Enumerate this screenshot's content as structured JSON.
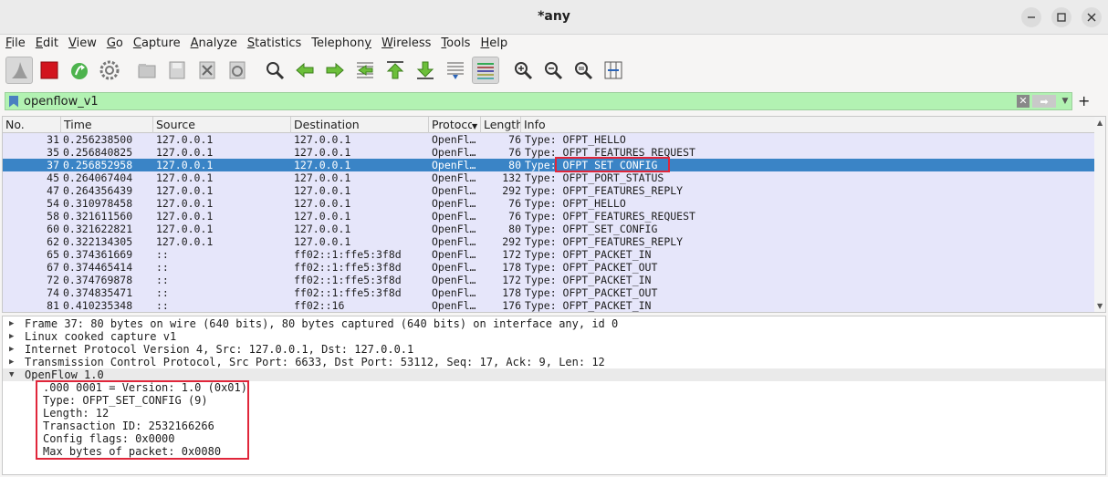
{
  "window": {
    "title": "*any"
  },
  "menu": [
    "File",
    "Edit",
    "View",
    "Go",
    "Capture",
    "Analyze",
    "Statistics",
    "Telephony",
    "Wireless",
    "Tools",
    "Help"
  ],
  "menu_underline": [
    "F",
    "E",
    "V",
    "G",
    "C",
    "A",
    "S",
    "y",
    "W",
    "T",
    "H"
  ],
  "toolbar_icons": [
    "shark-fin-icon",
    "stop-icon",
    "restart-icon",
    "options-gear-icon",
    "open-folder-icon",
    "save-icon",
    "close-file-icon",
    "reload-icon",
    "find-icon",
    "back-icon",
    "forward-icon",
    "go-to-packet-icon",
    "first-packet-icon",
    "last-packet-icon",
    "autoscroll-icon",
    "colorize-icon",
    "zoom-in-icon",
    "zoom-out-icon",
    "normal-size-icon",
    "resize-columns-icon"
  ],
  "filter": {
    "value": "openflow_v1",
    "clear": "✕",
    "apply": "➡",
    "add": "+"
  },
  "columns": [
    "No.",
    "Time",
    "Source",
    "Destination",
    "Protocol",
    "Length",
    "Info"
  ],
  "packets": [
    {
      "no": "31",
      "time": "0.256238500",
      "src": "127.0.0.1",
      "dst": "127.0.0.1",
      "proto": "OpenFl…",
      "len": "76",
      "info": "Type: OFPT_HELLO"
    },
    {
      "no": "35",
      "time": "0.256840825",
      "src": "127.0.0.1",
      "dst": "127.0.0.1",
      "proto": "OpenFl…",
      "len": "76",
      "info": "Type: OFPT_FEATURES_REQUEST"
    },
    {
      "no": "37",
      "time": "0.256852958",
      "src": "127.0.0.1",
      "dst": "127.0.0.1",
      "proto": "OpenFl…",
      "len": "80",
      "info": "Type: OFPT_SET_CONFIG",
      "selected": true
    },
    {
      "no": "45",
      "time": "0.264067404",
      "src": "127.0.0.1",
      "dst": "127.0.0.1",
      "proto": "OpenFl…",
      "len": "132",
      "info": "Type: OFPT_PORT_STATUS"
    },
    {
      "no": "47",
      "time": "0.264356439",
      "src": "127.0.0.1",
      "dst": "127.0.0.1",
      "proto": "OpenFl…",
      "len": "292",
      "info": "Type: OFPT_FEATURES_REPLY"
    },
    {
      "no": "54",
      "time": "0.310978458",
      "src": "127.0.0.1",
      "dst": "127.0.0.1",
      "proto": "OpenFl…",
      "len": "76",
      "info": "Type: OFPT_HELLO"
    },
    {
      "no": "58",
      "time": "0.321611560",
      "src": "127.0.0.1",
      "dst": "127.0.0.1",
      "proto": "OpenFl…",
      "len": "76",
      "info": "Type: OFPT_FEATURES_REQUEST"
    },
    {
      "no": "60",
      "time": "0.321622821",
      "src": "127.0.0.1",
      "dst": "127.0.0.1",
      "proto": "OpenFl…",
      "len": "80",
      "info": "Type: OFPT_SET_CONFIG"
    },
    {
      "no": "62",
      "time": "0.322134305",
      "src": "127.0.0.1",
      "dst": "127.0.0.1",
      "proto": "OpenFl…",
      "len": "292",
      "info": "Type: OFPT_FEATURES_REPLY"
    },
    {
      "no": "65",
      "time": "0.374361669",
      "src": "::",
      "dst": "ff02::1:ffe5:3f8d",
      "proto": "OpenFl…",
      "len": "172",
      "info": "Type: OFPT_PACKET_IN"
    },
    {
      "no": "67",
      "time": "0.374465414",
      "src": "::",
      "dst": "ff02::1:ffe5:3f8d",
      "proto": "OpenFl…",
      "len": "178",
      "info": "Type: OFPT_PACKET_OUT"
    },
    {
      "no": "72",
      "time": "0.374769878",
      "src": "::",
      "dst": "ff02::1:ffe5:3f8d",
      "proto": "OpenFl…",
      "len": "172",
      "info": "Type: OFPT_PACKET_IN"
    },
    {
      "no": "74",
      "time": "0.374835471",
      "src": "::",
      "dst": "ff02::1:ffe5:3f8d",
      "proto": "OpenFl…",
      "len": "178",
      "info": "Type: OFPT_PACKET_OUT"
    },
    {
      "no": "81",
      "time": "0.410235348",
      "src": "::",
      "dst": "ff02::16",
      "proto": "OpenFl…",
      "len": "176",
      "info": "Type: OFPT_PACKET_IN"
    }
  ],
  "details": [
    {
      "text": "Frame 37: 80 bytes on wire (640 bits), 80 bytes captured (640 bits) on interface any, id 0",
      "expanded": false
    },
    {
      "text": "Linux cooked capture v1",
      "expanded": false
    },
    {
      "text": "Internet Protocol Version 4, Src: 127.0.0.1, Dst: 127.0.0.1",
      "expanded": false
    },
    {
      "text": "Transmission Control Protocol, Src Port: 6633, Dst Port: 53112, Seq: 17, Ack: 9, Len: 12",
      "expanded": false
    },
    {
      "text": "OpenFlow 1.0",
      "expanded": true
    }
  ],
  "openflow_fields": [
    ".000 0001 = Version: 1.0 (0x01)",
    "Type: OFPT_SET_CONFIG (9)",
    "Length: 12",
    "Transaction ID: 2532166266",
    "Config flags: 0x0000",
    "Max bytes of packet: 0x0080"
  ],
  "colors": {
    "selected_row": "#3a84c6",
    "row_bg": "#e6e6fa",
    "filter_valid": "#b2f2b2",
    "highlight": "#e0263a"
  }
}
